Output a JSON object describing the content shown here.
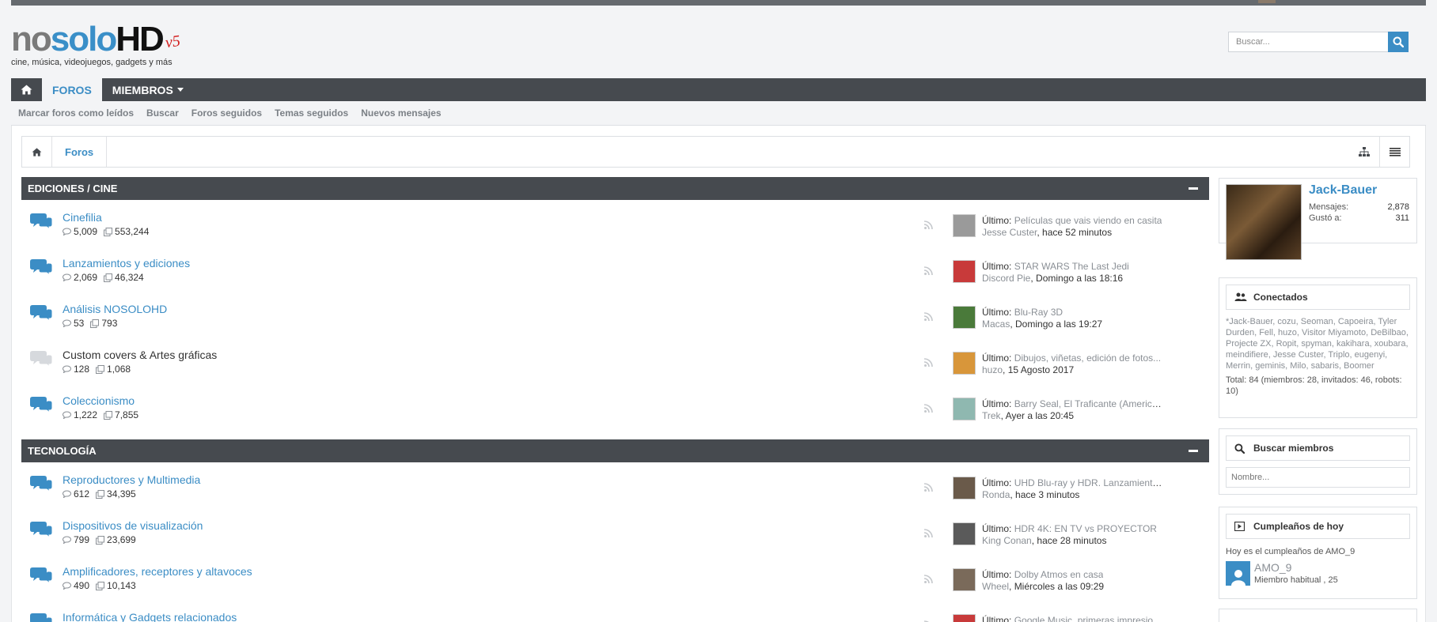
{
  "header": {
    "logo": {
      "part1": "no",
      "part2": "solo",
      "part3": "HD",
      "version": "v5",
      "tagline": "cine, música, videojuegos, gadgets y más"
    },
    "search": {
      "placeholder": "Buscar..."
    }
  },
  "nav": {
    "tabs": [
      {
        "label": "FOROS"
      },
      {
        "label": "MIEMBROS"
      }
    ]
  },
  "subnav": {
    "links": [
      "Marcar foros como leídos",
      "Buscar",
      "Foros seguidos",
      "Temas seguidos",
      "Nuevos mensajes"
    ]
  },
  "breadcrumb": {
    "current": "Foros"
  },
  "categories": [
    {
      "title": "EDICIONES / CINE",
      "forums": [
        {
          "title": "Cinefilia",
          "threads": "5,009",
          "posts": "553,244",
          "unread": true,
          "last_label": "Último:",
          "last_title": "Películas que vais viendo en casita",
          "last_user": "Jesse Custer",
          "last_time": "hace 52 minutos",
          "avatar_color": "#9a9a9a"
        },
        {
          "title": "Lanzamientos y ediciones",
          "threads": "2,069",
          "posts": "46,324",
          "unread": true,
          "last_label": "Último:",
          "last_title": "STAR WARS The Last Jedi",
          "last_user": "Discord Pie",
          "last_time": "Domingo a las 18:16",
          "avatar_color": "#c83a3a"
        },
        {
          "title": "Análisis NOSOLOHD",
          "threads": "53",
          "posts": "793",
          "unread": true,
          "last_label": "Último:",
          "last_title": "Blu-Ray 3D",
          "last_user": "Macas",
          "last_time": "Domingo a las 19:27",
          "avatar_color": "#4a7a3a"
        },
        {
          "title": "Custom covers & Artes gráficas",
          "threads": "128",
          "posts": "1,068",
          "unread": false,
          "last_label": "Último:",
          "last_title": "Dibujos, viñetas, edición de fotos...",
          "last_user": "huzo",
          "last_time": "15 Agosto 2017",
          "avatar_color": "#d8963a"
        },
        {
          "title": "Coleccionismo",
          "threads": "1,222",
          "posts": "7,855",
          "unread": true,
          "last_label": "Último:",
          "last_title": "Barry Seal, El Traficante (American Mad...",
          "last_user": "Trek",
          "last_time": "Ayer a las 20:45",
          "avatar_color": "#8fb8b0"
        }
      ]
    },
    {
      "title": "TECNOLOGÍA",
      "forums": [
        {
          "title": "Reproductores y Multimedia",
          "threads": "612",
          "posts": "34,395",
          "unread": true,
          "last_label": "Último:",
          "last_title": "UHD Blu-ray y HDR. Lanzamientos y rep...",
          "last_user": "Ronda",
          "last_time": "hace 3 minutos",
          "avatar_color": "#6a5a4a"
        },
        {
          "title": "Dispositivos de visualización",
          "threads": "799",
          "posts": "23,699",
          "unread": true,
          "last_label": "Último:",
          "last_title": "HDR 4K: EN TV vs PROYECTOR",
          "last_user": "King Conan",
          "last_time": "hace 28 minutos",
          "avatar_color": "#5a5a5a"
        },
        {
          "title": "Amplificadores, receptores y altavoces",
          "threads": "490",
          "posts": "10,143",
          "unread": true,
          "last_label": "Último:",
          "last_title": "Dolby Atmos en casa",
          "last_user": "Wheel",
          "last_time": "Miércoles a las 09:29",
          "avatar_color": "#7a6a5a"
        },
        {
          "title": "Informática y Gadgets relacionados",
          "threads": "",
          "posts": "",
          "unread": true,
          "last_label": "Último:",
          "last_title": "Google Music, primeras impresiones",
          "last_user": "",
          "last_time": "",
          "avatar_color": "#c83a3a"
        }
      ]
    }
  ],
  "sidebar": {
    "profile": {
      "name": "Jack-Bauer",
      "messages_label": "Mensajes:",
      "messages_value": "2,878",
      "likes_label": "Gustó a:",
      "likes_value": "311"
    },
    "online": {
      "title": "Conectados",
      "list": "*Jack-Bauer, cozu, Seoman, Capoeira, Tyler Durden, Fell, huzo, Visitor Miyamoto, DeBilbao, Projecte ZX, Ropit, spyman, kakihara, xoubara, meindifiere, Jesse Custer, Triplo, eugenyi, Merrin, geminis, Milo, sabaris, Boomer",
      "total": "Total: 84 (miembros: 28, invitados: 46, robots: 10)"
    },
    "member_search": {
      "title": "Buscar miembros",
      "placeholder": "Nombre..."
    },
    "birthdays": {
      "title": "Cumpleaños de hoy",
      "text": "Hoy es el cumpleaños de AMO_9",
      "user": "AMO_9",
      "role": "Miembro habitual , 25"
    }
  },
  "colors": {
    "accent": "#3b8dc5",
    "dark_bar": "#464a4f",
    "background": "#f3f4f6"
  },
  "icons": [
    "home-icon",
    "search-icon",
    "chat-bubbles-icon",
    "rss-icon",
    "sitemap-icon",
    "list-icon",
    "users-icon",
    "birthday-icon"
  ]
}
